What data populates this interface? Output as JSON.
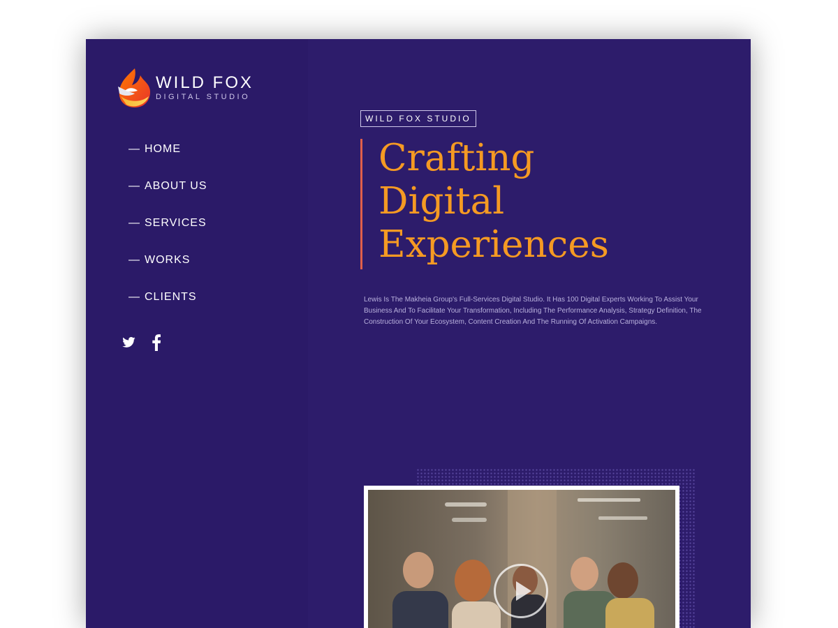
{
  "brand": {
    "title": "WILD FOX",
    "subtitle": "DIGITAL STUDIO"
  },
  "nav": {
    "items": [
      {
        "label": "HOME"
      },
      {
        "label": "ABOUT US"
      },
      {
        "label": "SERVICES"
      },
      {
        "label": "WORKS"
      },
      {
        "label": "CLIENTS"
      }
    ],
    "dash": "—"
  },
  "social": {
    "icons": [
      "twitter-icon",
      "facebook-icon"
    ]
  },
  "hero": {
    "tag": "WILD FOX STUDIO",
    "headline": [
      "Crafting",
      "Digital",
      "Experiences"
    ],
    "description": "Lewis Is The Makheia Group's Full-Services Digital Studio. It Has 100 Digital Experts Working To Assist Your Business And To Facilitate Your Transformation, Including The Performance Analysis, Strategy Definition, The Construction Of Your Ecosystem, Content Creation And The Running Of Activation Campaigns."
  },
  "video": {
    "icon": "play-icon"
  },
  "colors": {
    "background": "#2d1c6b",
    "accent": "#f59a23",
    "bar": "#e0604a"
  }
}
